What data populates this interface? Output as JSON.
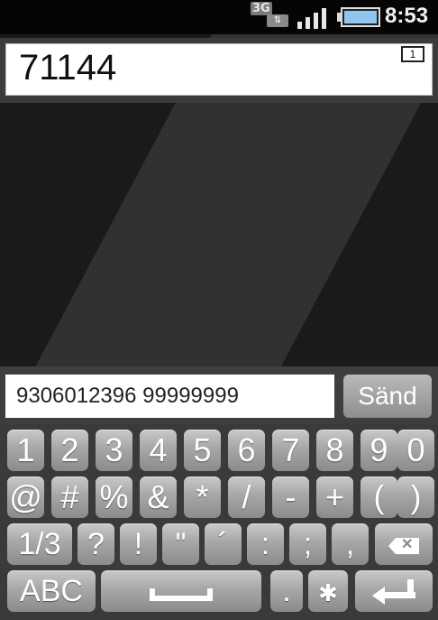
{
  "status_bar": {
    "network_label": "3G",
    "network_arrows": "⇅",
    "signal_icon": "signal-bars-icon",
    "battery_icon": "battery-icon",
    "battery_level": 1.0,
    "battery_color": "#8fc6f0",
    "time": "8:53"
  },
  "recipient": {
    "number": "71144",
    "count": "1"
  },
  "composer": {
    "message": "9306012396 99999999",
    "send_label": "Sänd"
  },
  "keyboard": {
    "row1": [
      "1",
      "2",
      "3",
      "4",
      "5",
      "6",
      "7",
      "8",
      "9",
      "0"
    ],
    "row2": [
      "@",
      "#",
      "%",
      "&",
      "*",
      "/",
      "-",
      "+",
      "(",
      ")"
    ],
    "row3": [
      "1/3",
      "?",
      "!",
      "\"",
      "´",
      ":",
      ";",
      ","
    ],
    "row3_backspace_icon": "backspace-icon",
    "row4": {
      "abc": "ABC",
      "space_icon": "space-icon",
      "period": ".",
      "settings_icon": "gear-icon",
      "enter_icon": "enter-icon"
    }
  },
  "colors": {
    "background": "#1a1a1a",
    "key_top": "#c9c9c9",
    "key_bottom": "#8b8b8b"
  }
}
